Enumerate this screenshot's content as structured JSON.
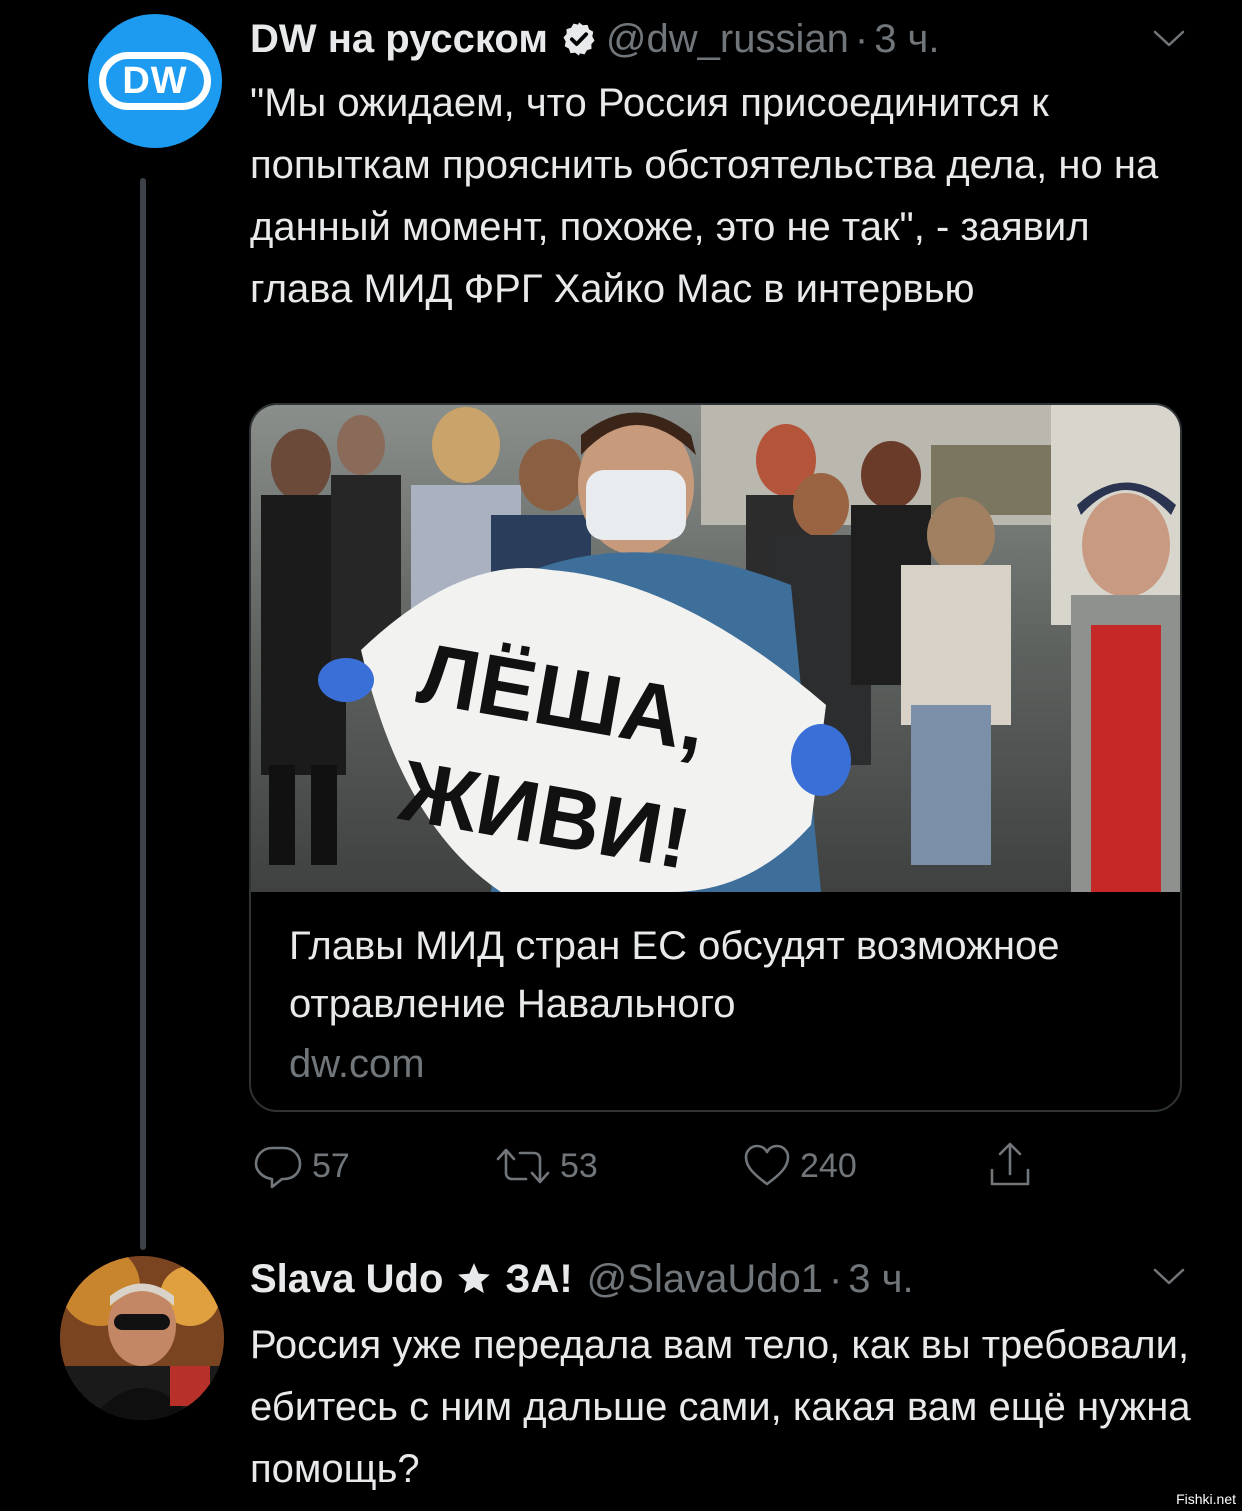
{
  "tweet1": {
    "author_name": "DW на русском",
    "handle": "@dw_russian",
    "dot": "·",
    "time": "3 ч.",
    "avatar_label": "DW",
    "text": "\"Мы ожидаем, что Россия присоединится к попыткам прояснить обстоятельства дела, но на данный момент, похоже, это не так\", - заявил глава МИД ФРГ Хайко Мас в интервью",
    "card": {
      "sign_line1": "ЛЁША,",
      "sign_line2": "ЖИВИ!",
      "title": "Главы МИД стран ЕС обсудят возможное отравление Навального",
      "domain": "dw.com"
    },
    "actions": {
      "replies": "57",
      "retweets": "53",
      "likes": "240"
    }
  },
  "tweet2": {
    "author_name": "Slava Udo",
    "name_suffix": "ЗА!",
    "handle": "@SlavaUdo1",
    "dot": "·",
    "time": "3 ч.",
    "text": "Россия уже передала вам тело, как вы требовали, ебитесь с ним дальше сами, какая вам ещё нужна помощь?"
  },
  "watermark": "Fishki.net",
  "colors": {
    "background": "#000000",
    "text_primary": "#e7e9ea",
    "text_secondary": "#71767b",
    "dw_blue": "#1d9bf0",
    "thread_line": "#3d4248"
  },
  "icons": [
    "verified-badge-icon",
    "chevron-down-icon",
    "reply-icon",
    "retweet-icon",
    "like-icon",
    "share-icon",
    "star-icon"
  ]
}
